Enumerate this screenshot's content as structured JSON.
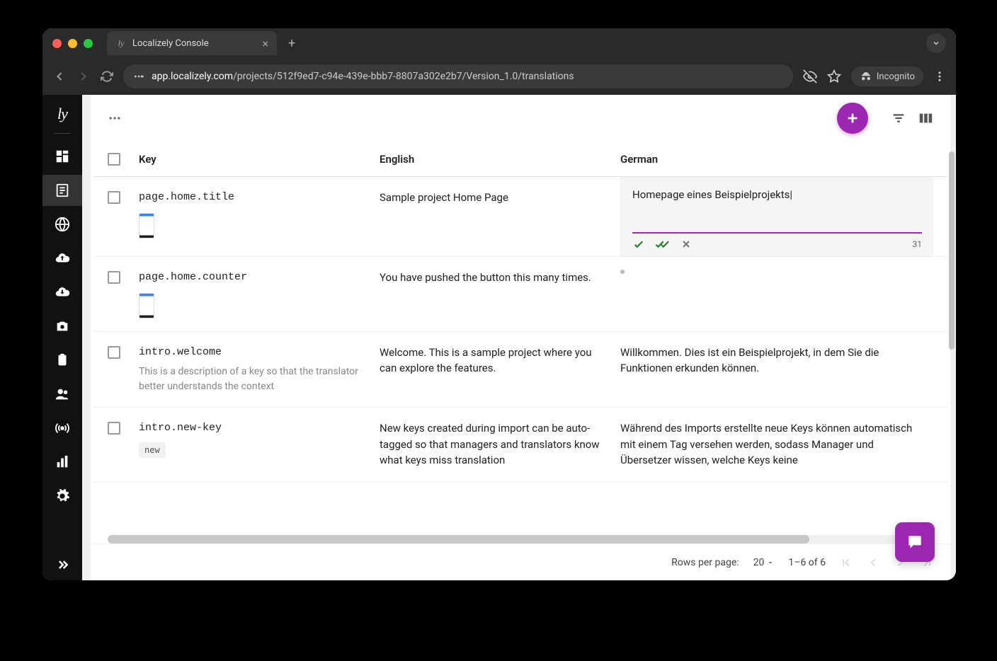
{
  "browser": {
    "tab_title": "Localizely Console",
    "url_prefix": "app.localizely.com",
    "url_path": "/projects/512f9ed7-c94e-439e-bbb7-8807a302e2b7/Version_1.0/translations",
    "incognito_label": "Incognito"
  },
  "columns": {
    "key": "Key",
    "english": "English",
    "german": "German"
  },
  "rows": [
    {
      "key": "page.home.title",
      "thumb": true,
      "en": "Sample project Home Page",
      "de": "Homepage eines Beispielprojekts",
      "editing": true,
      "char_count": "31"
    },
    {
      "key": "page.home.counter",
      "thumb": true,
      "en": "You have pushed the button this many times.",
      "de_empty": true
    },
    {
      "key": "intro.welcome",
      "desc": "This is a description of a key so that the translator better understands the context",
      "en": "Welcome. This is a sample project where you can explore the features.",
      "de": "Willkommen. Dies ist ein Beispielprojekt, in dem Sie die Funktionen erkunden können."
    },
    {
      "key": "intro.new-key",
      "tag": "new",
      "en": "New keys created during import can be auto-tagged so that managers and translators know what keys miss translation",
      "de": "Während des Imports erstellte neue Keys können automatisch mit einem Tag versehen werden, sodass Manager und Übersetzer wissen, welche Keys keine"
    }
  ],
  "pagination": {
    "rows_per_page_label": "Rows per page:",
    "rows_per_page_value": "20",
    "range": "1–6 of 6"
  }
}
